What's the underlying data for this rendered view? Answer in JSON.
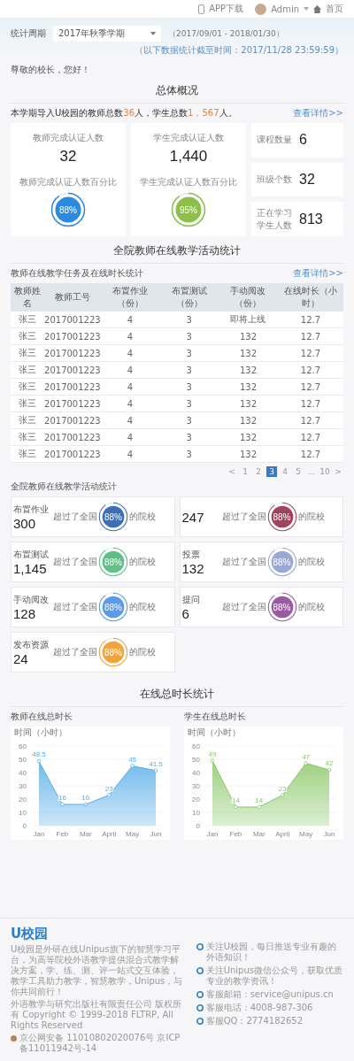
{
  "topbar": {
    "app_download": "APP下载",
    "user": "Admin",
    "home": "首页"
  },
  "filter": {
    "label": "统计周期",
    "select_value": "2017年秋季学期",
    "period": "（2017/09/01 - 2018/01/30）",
    "as_of": "（以下数据统计截至时间：2017/11/28 23:59:59）"
  },
  "greeting": "尊敬的校长，您好！",
  "overview": {
    "title": "总体概况",
    "summary": "本学期导入U校园的教师总数**36**人，学生总数**1，567**人。",
    "details_link": "查看详情>>",
    "main_cards": [
      {
        "label": "教师完成认证人数",
        "value": "32",
        "ratio_label": "教师完成认证人数百分比",
        "percent": "88%",
        "color": "#2a8ae0"
      },
      {
        "label": "学生完成认证人数",
        "value": "1,440",
        "ratio_label": "学生完成认证人数百分比",
        "percent": "95%",
        "color": "#8cc04a"
      }
    ],
    "side_cards": [
      {
        "label": "课程数量",
        "value": "6"
      },
      {
        "label": "班级个数",
        "value": "32"
      },
      {
        "label": "正在学习学生人数",
        "value": "813"
      }
    ]
  },
  "activity": {
    "title": "全院教师在线教学活动统计",
    "table_title": "教师在线教学任务及在线时长统计",
    "details_link": "查看详情>>",
    "columns": [
      "教师姓名",
      "教师工号",
      "布置作业（份）",
      "布置测试（份）",
      "手动阅改（份）",
      "在线时长（小时）"
    ],
    "rows": [
      [
        "张三",
        "2017001223",
        "4",
        "3",
        "即将上线",
        "12.7"
      ],
      [
        "张三",
        "2017001223",
        "4",
        "3",
        "132",
        "12.7"
      ],
      [
        "张三",
        "2017001223",
        "4",
        "3",
        "132",
        "12.7"
      ],
      [
        "张三",
        "2017001223",
        "4",
        "3",
        "132",
        "12.7"
      ],
      [
        "张三",
        "2017001223",
        "4",
        "3",
        "132",
        "12.7"
      ],
      [
        "张三",
        "2017001223",
        "4",
        "3",
        "132",
        "12.7"
      ],
      [
        "张三",
        "2017001223",
        "4",
        "3",
        "132",
        "12.7"
      ],
      [
        "张三",
        "2017001223",
        "4",
        "3",
        "132",
        "12.7"
      ],
      [
        "张三",
        "2017001223",
        "4",
        "3",
        "132",
        "12.7"
      ]
    ],
    "pages": [
      {
        "label": "<",
        "selected": false
      },
      {
        "label": "1",
        "selected": false
      },
      {
        "label": "2",
        "selected": false
      },
      {
        "label": "3",
        "selected": true
      },
      {
        "label": "4",
        "selected": false
      },
      {
        "label": "5",
        "selected": false
      },
      {
        "label": "...",
        "selected": false
      },
      {
        "label": "10",
        "selected": false
      },
      {
        "label": ">",
        "selected": false
      }
    ]
  },
  "tasks": {
    "title": "全院教师在线教学活动统计",
    "cards": [
      {
        "label": "布置作业",
        "value": "300",
        "before": "超过了全国",
        "percent": "88%",
        "after": "的院校",
        "color": "#3d6fb6"
      },
      {
        "value": "247",
        "before": "超过了全国",
        "percent": "88%",
        "after": "的院校",
        "color": "#a0445e"
      },
      {
        "label": "布置测试",
        "value": "1,145",
        "before": "超过了全国",
        "percent": "88%",
        "after": "的院校",
        "color": "#5fbf86"
      },
      {
        "label": "投票",
        "value": "132",
        "before": "超过了全国",
        "percent": "88%",
        "after": "的院校",
        "color": "#9aa8d6"
      },
      {
        "label": "手动阅改",
        "value": "128",
        "before": "超过了全国",
        "percent": "88%",
        "after": "的院校",
        "color": "#5b9ae8"
      },
      {
        "label": "提问",
        "value": "6",
        "before": "超过了全国",
        "percent": "88%",
        "after": "的院校",
        "color": "#9a5aa0"
      },
      {
        "label": "发布资源",
        "value": "24",
        "before": "超过了全国",
        "percent": "88%",
        "after": "的院校",
        "color": "#f2a33a"
      }
    ]
  },
  "online": {
    "title": "在线总时长统计",
    "charts": [
      {
        "title": "教师在线总时长",
        "chart_data": {
          "type": "area",
          "ylabel": "时间（小时）",
          "categories": [
            "Jan",
            "Feb",
            "Mar",
            "April",
            "May",
            "Jun"
          ],
          "ylim": [
            0,
            60
          ],
          "yticks": [
            0,
            10,
            20,
            30,
            40,
            50,
            60
          ],
          "data_labels": true,
          "grid": true,
          "series": [
            {
              "color": "#5aaee8",
              "values": [
                48.5,
                16,
                16,
                23,
                45,
                41.5
              ]
            }
          ]
        }
      },
      {
        "title": "学生在线总时长",
        "chart_data": {
          "type": "area",
          "ylabel": "时间（小时）",
          "categories": [
            "Jan",
            "Feb",
            "Mar",
            "April",
            "May",
            "Jun"
          ],
          "ylim": [
            0,
            60
          ],
          "yticks": [
            0,
            10,
            20,
            30,
            40,
            50,
            60
          ],
          "data_labels": true,
          "grid": true,
          "series": [
            {
              "color": "#8cc86a",
              "values": [
                49,
                14,
                14,
                23,
                47,
                42
              ]
            }
          ]
        }
      }
    ]
  },
  "footer": {
    "logo": "U校园",
    "description": "U校园是外研在线Unipus旗下的智慧学习平台，为高等院校外语教学提供混合式教学解决方案，学、练、测、评一站式交互体验，教学工具助力教学，智慧教学，Unipus，与你共同前行！",
    "copyright": "外语教学与研究出版社有限责任公司 版权所有 Copyright © 1999-2018 FLTRP, All Rights Reserved",
    "license": "京公网安备 11010802020076号 京ICP备11011942号-14",
    "contacts": [
      "关注U校园，每日推送专业有趣的外语知识！",
      "关注Unipus微信公众号，获取优质专业的教学资讯！",
      "客服邮箱：service@unipus.cn",
      "客服电话：4008-987-306",
      "客服QQ：2774182652"
    ]
  }
}
